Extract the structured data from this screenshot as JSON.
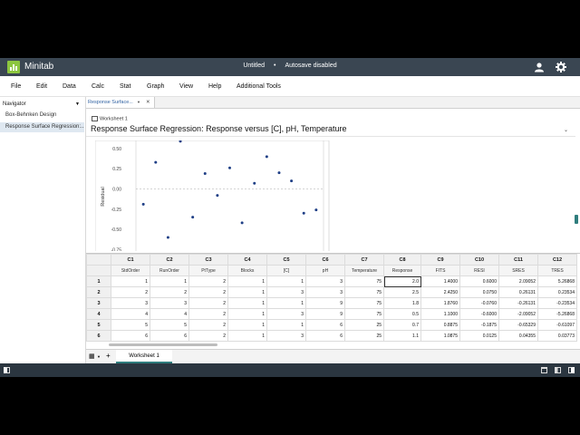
{
  "app": {
    "name": "Minitab",
    "document_title": "Untitled",
    "autosave_status": "Autosave disabled"
  },
  "menu": [
    "File",
    "Edit",
    "Data",
    "Calc",
    "Stat",
    "Graph",
    "View",
    "Help",
    "Additional Tools"
  ],
  "navigator": {
    "title": "Navigator",
    "items": [
      "Box-Behnken Design",
      "Response Surface Regression:..."
    ]
  },
  "output": {
    "tab_label": "Response Surface...",
    "worksheet_ref": "Worksheet 1",
    "title": "Response Surface Regression: Response versus [C], pH, Temperature"
  },
  "chart_data": {
    "type": "scatter",
    "title": "",
    "xlabel": "",
    "ylabel": "Residual",
    "ylim": [
      -0.78,
      0.6
    ],
    "yticks": [
      "0.50",
      "0.25",
      "0.00",
      "-0.25",
      "-0.50",
      "-0.75"
    ],
    "x": [
      1,
      2,
      3,
      4,
      5,
      6,
      7,
      8,
      9,
      10,
      11,
      12,
      13,
      14,
      15
    ],
    "values": [
      -0.19,
      0.33,
      -0.6,
      0.59,
      -0.35,
      0.19,
      -0.08,
      0.26,
      -0.42,
      0.07,
      0.4,
      0.2,
      0.1,
      -0.3,
      -0.26
    ],
    "series": [
      {
        "values": [
          -0.19,
          0.33,
          -0.6,
          0.59,
          -0.35,
          0.19,
          -0.08,
          0.26,
          -0.42,
          0.07,
          0.4,
          0.2,
          0.1,
          -0.3,
          -0.26
        ]
      }
    ],
    "reference_line": 0,
    "grid": false
  },
  "worksheet": {
    "columns": [
      {
        "id": "C1",
        "name": "StdOrder"
      },
      {
        "id": "C2",
        "name": "RunOrder"
      },
      {
        "id": "C3",
        "name": "PtType"
      },
      {
        "id": "C4",
        "name": "Blocks"
      },
      {
        "id": "C5",
        "name": "[C]"
      },
      {
        "id": "C6",
        "name": "pH"
      },
      {
        "id": "C7",
        "name": "Temperature"
      },
      {
        "id": "C8",
        "name": "Response"
      },
      {
        "id": "C9",
        "name": "FITS"
      },
      {
        "id": "C10",
        "name": "RESI"
      },
      {
        "id": "C11",
        "name": "SRES"
      },
      {
        "id": "C12",
        "name": "TRES"
      }
    ],
    "rows": [
      [
        "1",
        "1",
        "1",
        "2",
        "1",
        "1",
        "3",
        "75",
        "2.0",
        "1.4000",
        "0.6000",
        "2.09052",
        "5.26868"
      ],
      [
        "2",
        "2",
        "2",
        "2",
        "1",
        "3",
        "3",
        "75",
        "2.5",
        "2.4250",
        "0.0750",
        "0.26131",
        "0.23534"
      ],
      [
        "3",
        "3",
        "3",
        "2",
        "1",
        "1",
        "9",
        "75",
        "1.8",
        "1.8760",
        "-0.0760",
        "-0.26131",
        "-0.23534"
      ],
      [
        "4",
        "4",
        "4",
        "2",
        "1",
        "3",
        "9",
        "75",
        "0.5",
        "1.1000",
        "-0.6000",
        "-2.09052",
        "-5.26868"
      ],
      [
        "5",
        "5",
        "5",
        "2",
        "1",
        "1",
        "6",
        "25",
        "0.7",
        "0.8875",
        "-0.1875",
        "-0.65329",
        "-0.61097"
      ],
      [
        "6",
        "6",
        "6",
        "2",
        "1",
        "3",
        "6",
        "25",
        "1.1",
        "1.0875",
        "0.0125",
        "0.04355",
        "0.03773"
      ]
    ],
    "selected": {
      "row": 0,
      "col": 7
    }
  },
  "sheet_tabs": {
    "active": "Worksheet 1",
    "add_label": "+"
  },
  "colors": {
    "titlebar": "#3a4652",
    "statusbar": "#2b3640",
    "accent": "#2f7d7d",
    "logo": "#8cc63f",
    "point": "#1f3f86"
  }
}
